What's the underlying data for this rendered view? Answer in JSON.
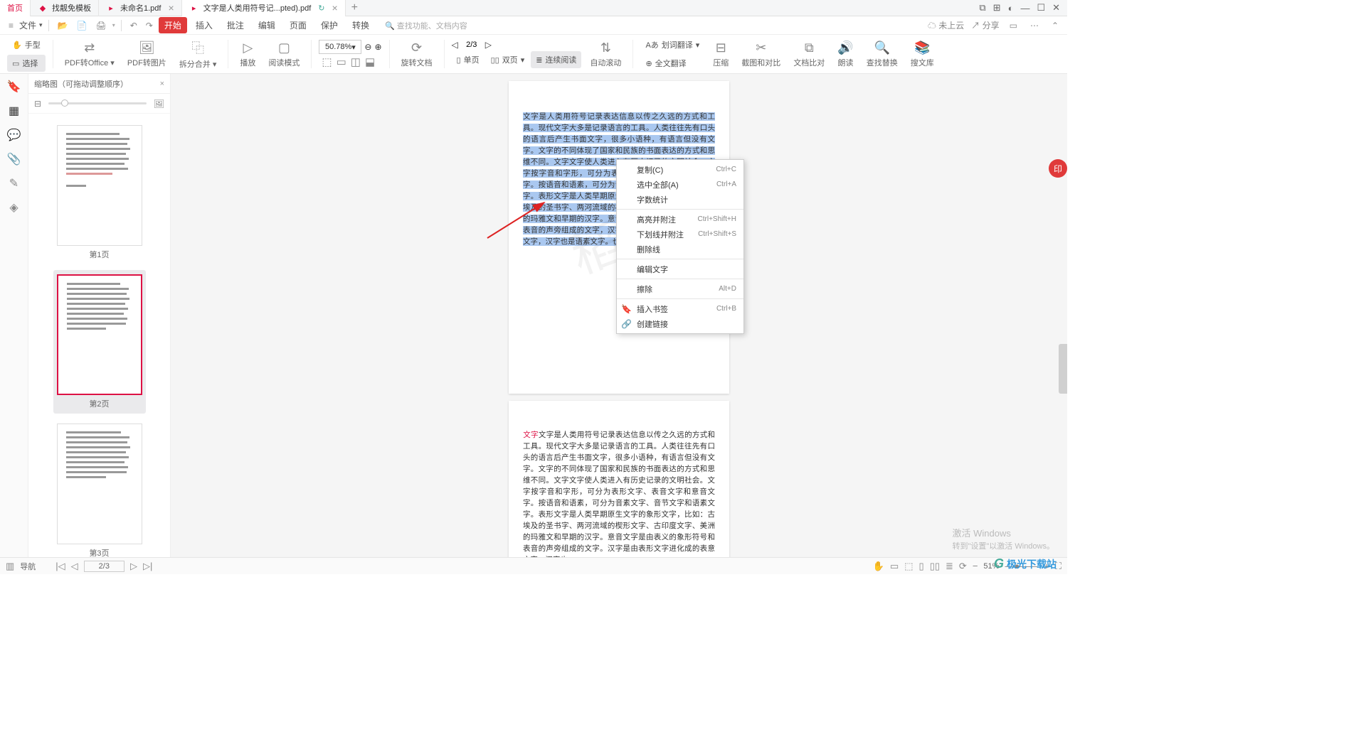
{
  "tabs": {
    "home": "首页",
    "t1": "找靓免模板",
    "t2": "未命名1.pdf",
    "t3": "文字是人类用符号记...pted).pdf"
  },
  "win": {
    "dual": "⧉",
    "grid": "⊞",
    "skin": "◐",
    "min": "—",
    "max": "☐",
    "close": "✕"
  },
  "menu": {
    "file": "文件",
    "items": [
      "开始",
      "插入",
      "批注",
      "编辑",
      "页面",
      "保护",
      "转换"
    ],
    "search": "查找功能、文档内容",
    "cloud": "未上云",
    "share": "分享"
  },
  "ribbon": {
    "hand": "手型",
    "select": "选择",
    "pdf2office": "PDF转Office",
    "pdf2img": "PDF转图片",
    "split": "拆分合并",
    "play": "播放",
    "readmode": "阅读模式",
    "zoom": "50.78%",
    "page": "2/3",
    "rotate": "旋转文档",
    "single": "单页",
    "dual": "双页",
    "cont": "连续阅读",
    "auto": "自动滚动",
    "wordtrans": "划词翻译",
    "fulltrans": "全文翻译",
    "compress": "压缩",
    "snap": "截图和对比",
    "compare": "文档比对",
    "read": "朗读",
    "find": "查找替换",
    "lib": "搜文库"
  },
  "side": {
    "title": "缩略图（可拖动调整顺序）",
    "p1": "第1页",
    "p2": "第2页",
    "p3": "第3页"
  },
  "ctx": {
    "copy": "复制(C)",
    "copy_sc": "Ctrl+C",
    "selall": "选中全部(A)",
    "selall_sc": "Ctrl+A",
    "wc": "字数统计",
    "hl": "高亮并附注",
    "hl_sc": "Ctrl+Shift+H",
    "ul": "下划线并附注",
    "ul_sc": "Ctrl+Shift+S",
    "strike": "删除线",
    "edit": "编辑文字",
    "erase": "擦除",
    "erase_sc": "Alt+D",
    "bm": "插入书签",
    "bm_sc": "Ctrl+B",
    "link": "创建链接"
  },
  "doc": {
    "p2_sel": "文字是人类用符号记录表达信息以传之久远的方式和工具。现代文字大多是记录语言的工具。人类往往先有口头的语言后产生书面文字，很多小语种，有语言但没有文字。文字的不同体现了国家和民族的书面表达的方式和思维不同。文字文字使人类进入有历史记录的文明社会。文字按字音和字形，可分为表形文字、表音文字和意音文字。按语音和语素，可分为音素文字、音节文字和语素文字。表形文字是人类早期原生文字的象形文字，比如：古埃及的圣书字、两河流域的楔形文字、古印度文字、美洲的玛雅文和早期的汉字。意音文字是由表义的象形符号和表音的声旁组成的文字，汉字是由表形文字进化成的表意文字，汉字也是语素文字。也是一种二维",
    "p3": "文字是人类用符号记录表达信息以传之久远的方式和工具。现代文字大多是记录语言的工具。人类往往先有口头的语言后产生书面文字，很多小语种，有语言但没有文字。文字的不同体现了国家和民族的书面表达的方式和思维不同。文字文字使人类进入有历史记录的文明社会。文字按字音和字形，可分为表形文字、表音文字和意音文字。按语音和语素，可分为音素文字、音节文字和语素文字。表形文字是人类早期原生文字的象形文字，比如：古埃及的圣书字、两河流域的楔形文字、古印度文字、美洲的玛雅文和早期的汉字。意音文字是由表义的象形符号和表音的声旁组成的文字。汉字是由表形文字进化成的表意文字，汉字也"
  },
  "status": {
    "nav": "导航",
    "page": "2/3",
    "zoom": "51%"
  },
  "activate": {
    "l1": "激活 Windows",
    "l2": "转到\"设置\"以激活 Windows。"
  },
  "brand": "极光下载站"
}
